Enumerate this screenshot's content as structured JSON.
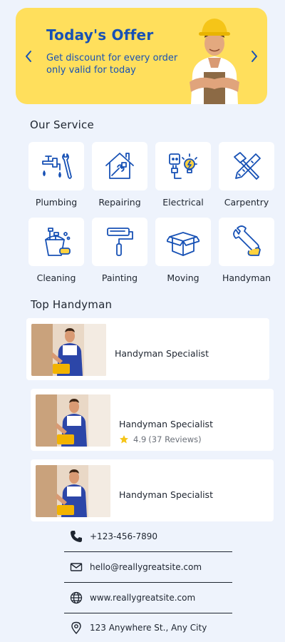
{
  "offer": {
    "title": "Today's Offer",
    "text": "Get discount for every order only valid for today",
    "bg_color": "#ffdf5c",
    "accent_color": "#1751b5"
  },
  "services": {
    "title": "Our Service",
    "items": [
      {
        "label": "Plumbing",
        "icon": "plumbing-icon"
      },
      {
        "label": "Repairing",
        "icon": "house-repair-icon"
      },
      {
        "label": "Electrical",
        "icon": "electrical-plug-icon"
      },
      {
        "label": "Carpentry",
        "icon": "carpentry-tools-icon"
      },
      {
        "label": "Cleaning",
        "icon": "cleaning-bucket-icon"
      },
      {
        "label": "Painting",
        "icon": "paint-roller-icon"
      },
      {
        "label": "Moving",
        "icon": "moving-box-icon"
      },
      {
        "label": "Handyman",
        "icon": "wrench-hand-icon"
      }
    ]
  },
  "top_handyman": {
    "title": "Top Handyman",
    "cards": [
      {
        "name": "Handyman Specialist"
      },
      {
        "name": "Handyman Specialist",
        "rating": "4.9",
        "reviews": "(37 Reviews)"
      },
      {
        "name": "Handyman Specialist"
      }
    ]
  },
  "contacts": [
    {
      "icon": "phone-icon",
      "text": "+123-456-7890"
    },
    {
      "icon": "mail-icon",
      "text": "hello@reallygreatsite.com"
    },
    {
      "icon": "globe-icon",
      "text": "www.reallygreatsite.com"
    },
    {
      "icon": "location-pin-icon",
      "text": "123 Anywhere  St., Any City"
    }
  ]
}
